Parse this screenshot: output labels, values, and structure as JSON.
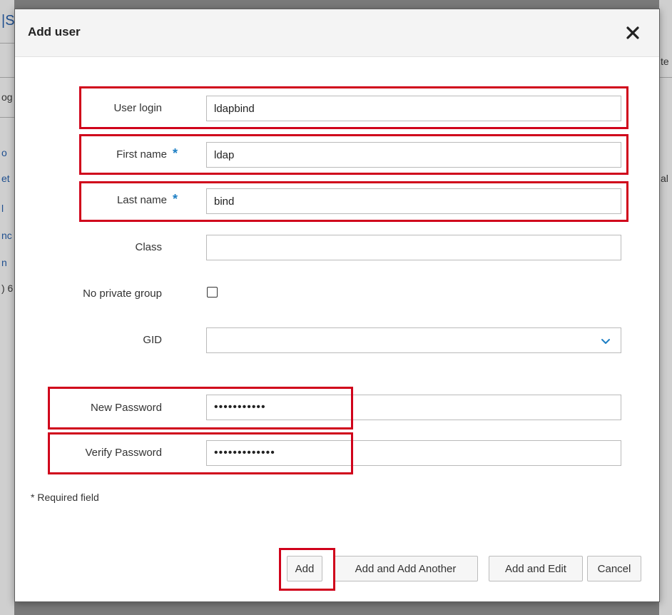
{
  "dialog": {
    "title": "Add user",
    "close_icon": "close-icon"
  },
  "form": {
    "user_login": {
      "label": "User login",
      "value": "ldapbind"
    },
    "first_name": {
      "label": "First name",
      "value": "ldap",
      "required_mark": "*"
    },
    "last_name": {
      "label": "Last name",
      "value": "bind",
      "required_mark": "*"
    },
    "class": {
      "label": "Class",
      "value": ""
    },
    "no_private_group": {
      "label": "No private group",
      "checked": false
    },
    "gid": {
      "label": "GID",
      "value": "",
      "icon": "chevron-down-icon"
    },
    "new_password": {
      "label": "New Password",
      "value": "•••••••••••"
    },
    "verify_password": {
      "label": "Verify Password",
      "value": "•••••••••••••"
    }
  },
  "required_note": "* Required field",
  "buttons": {
    "add": "Add",
    "add_another": "Add and Add Another",
    "add_edit": "Add and Edit",
    "cancel": "Cancel"
  },
  "background_fragments": [
    "|S",
    "te",
    "og",
    "o",
    "et",
    "al",
    "l",
    "nc",
    "n",
    ") 6"
  ],
  "colors": {
    "highlight": "#d0021b",
    "required": "#1e7fc4",
    "header_bg": "#f4f4f4"
  }
}
